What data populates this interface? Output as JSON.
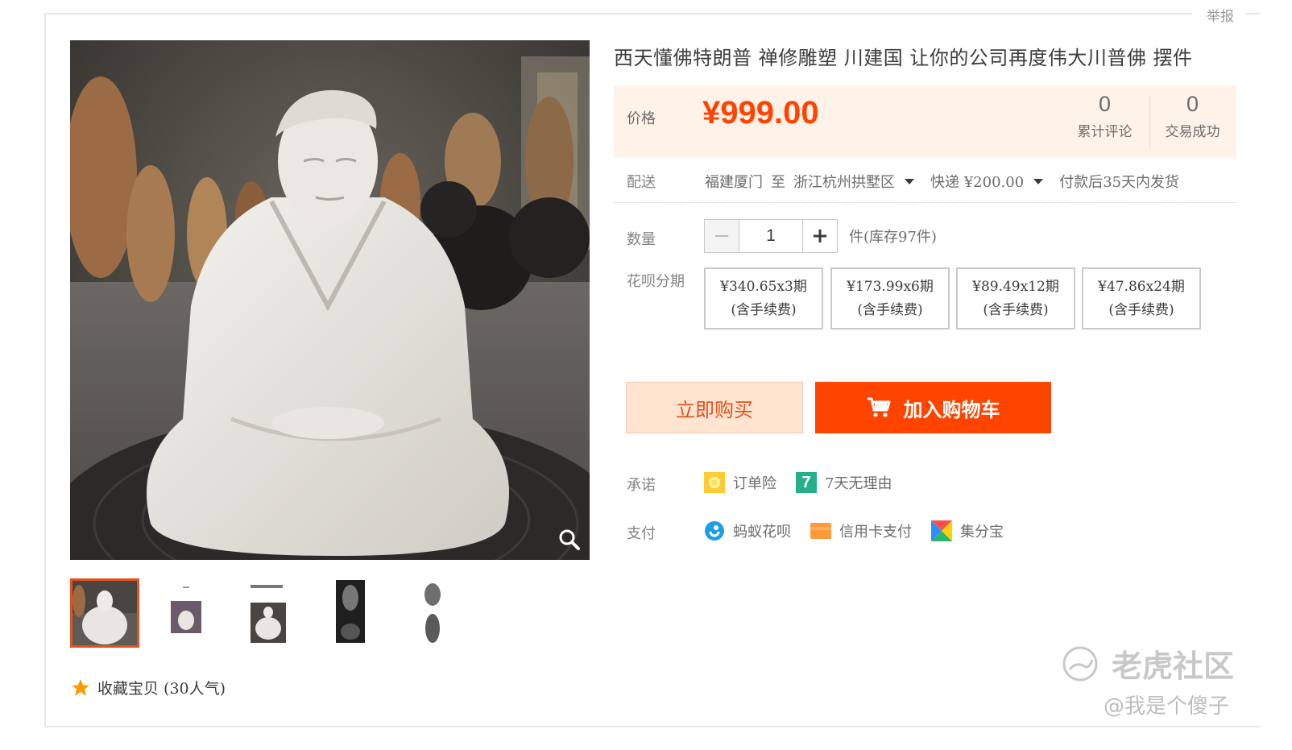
{
  "report_link": "举报",
  "product": {
    "title": "西天懂佛特朗普 禅修雕塑 川建国 让你的公司再度伟大川普佛 摆件",
    "price_label": "价格",
    "price": "¥999.00",
    "stats": [
      {
        "value": "0",
        "label": "累计评论"
      },
      {
        "value": "0",
        "label": "交易成功"
      }
    ]
  },
  "shipping": {
    "label": "配送",
    "from": "福建厦门",
    "to_word": "至",
    "to": "浙江杭州拱墅区",
    "method": "快递 ¥200.00",
    "delivery_time": "付款后35天内发货"
  },
  "quantity": {
    "label": "数量",
    "minus": "−",
    "value": "1",
    "plus": "+",
    "stock": "件(库存97件)"
  },
  "installments": {
    "label": "花呗分期",
    "options": [
      {
        "amount": "¥340.65x3期",
        "fee": "(含手续费)"
      },
      {
        "amount": "¥173.99x6期",
        "fee": "(含手续费)"
      },
      {
        "amount": "¥89.49x12期",
        "fee": "(含手续费)"
      },
      {
        "amount": "¥47.86x24期",
        "fee": "(含手续费)"
      }
    ]
  },
  "actions": {
    "buy_now": "立即购买",
    "add_to_cart": "加入购物车"
  },
  "promise": {
    "label": "承诺",
    "items": [
      "订单险",
      "7天无理由"
    ],
    "seven_badge": "7"
  },
  "payment": {
    "label": "支付",
    "items": [
      "蚂蚁花呗",
      "信用卡支付",
      "集分宝"
    ]
  },
  "favorite": "收藏宝贝 (30人气)",
  "watermark": {
    "brand": "老虎社区",
    "user": "@我是个傻子"
  },
  "colors": {
    "accent": "#ff4400",
    "price": "#ff4400",
    "price_bg": "#fff2e8"
  }
}
